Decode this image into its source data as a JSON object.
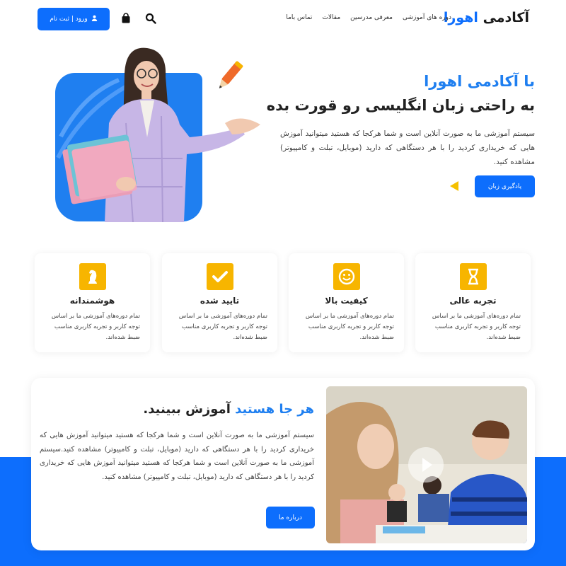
{
  "header": {
    "logo_part1": "آکادمی",
    "logo_part2": "اهورا",
    "nav": [
      "دوره های آموزشی",
      "معرفی مدرسین",
      "مقالات",
      "تماس باما"
    ],
    "login_label": "ورود | ثبت نام"
  },
  "hero": {
    "title_line1": "با آکادمی اهورا",
    "title_line2": "به راحتی زبان انگلیسی رو قورت بده",
    "text": "سیستم آموزشی ما به صورت آنلاین است و شما هرکجا که هستید میتوانید آموزش هایی که خریداری کردید را با هر دستگاهی که دارید (موبایل، تبلت و کامپیوتر) مشاهده کنید.",
    "button_label": "یادگیری زبان"
  },
  "features": [
    {
      "title": "هوشمندانه",
      "text": "تمام دوره‌های آموزشی ما بر اساس توجه کاربر و تجربه کاربری مناسب ضبط شده‌اند.",
      "icon": "chess-knight-icon"
    },
    {
      "title": "تایید شده",
      "text": "تمام دوره‌های آموزشی ما بر اساس توجه کاربر و تجربه کاربری مناسب ضبط شده‌اند.",
      "icon": "check-icon"
    },
    {
      "title": "کیفیت بالا",
      "text": "تمام دوره‌های آموزشی ما بر اساس توجه کاربر و تجربه کاربری مناسب ضبط شده‌اند.",
      "icon": "smile-icon"
    },
    {
      "title": "تجربه عالی",
      "text": "تمام دوره‌های آموزشی ما بر اساس توجه کاربر و تجربه کاربری مناسب ضبط شده‌اند.",
      "icon": "hourglass-icon"
    }
  ],
  "about": {
    "title_highlight": "هر جا هستید",
    "title_rest": "آموزش ببینید.",
    "text": "سیستم آموزشی ما به صورت آنلاین است و شما هرکجا که هستید میتوانید آموزش هایی که خریداری کردید را با هر دستگاهی که دارید (موبایل، تبلت و کامپیوتر) مشاهده کنید.سیستم آموزشی ما به صورت آنلاین است و شما هرکجا که هستید میتوانید آموزش هایی که خریداری کردید را با هر دستگاهی که دارید (موبایل، تبلت و کامپیوتر) مشاهده کنید.",
    "button_label": "درباره ما"
  },
  "colors": {
    "primary": "#0d6efd",
    "accent": "#f7b500"
  }
}
